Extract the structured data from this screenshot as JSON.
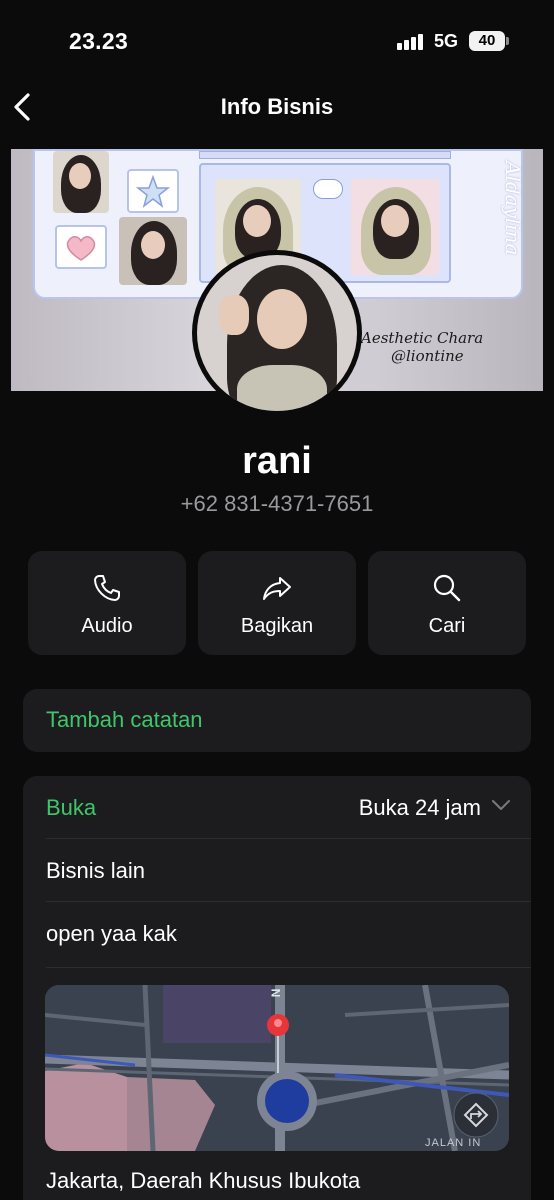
{
  "status_bar": {
    "time": "23.23",
    "network": "5G",
    "battery": "40"
  },
  "nav": {
    "title": "Info Bisnis",
    "back_icon": "chevron-left-icon"
  },
  "banner": {
    "signature_line1": "Aesthetic Chara",
    "signature_line2": "@liontine",
    "vertical_text": "Aldaylina"
  },
  "profile": {
    "name": "rani",
    "phone": "+62 831-4371-7651"
  },
  "actions": [
    {
      "label": "Audio",
      "icon": "phone-icon"
    },
    {
      "label": "Bagikan",
      "icon": "share-icon"
    },
    {
      "label": "Cari",
      "icon": "search-icon"
    }
  ],
  "note": {
    "label": "Tambah catatan"
  },
  "info": {
    "hours_label": "Buka",
    "hours_value": "Buka 24 jam",
    "category": "Bisnis lain",
    "description": "open yaa kak",
    "map_compass": "N",
    "map_street": "JALAN IN",
    "address": "Jakarta, Daerah Khusus Ibukota"
  },
  "colors": {
    "background": "#0b0b0c",
    "card": "#1c1c1e",
    "accent_green": "#3fc66b",
    "secondary_text": "#9a9a9e"
  }
}
